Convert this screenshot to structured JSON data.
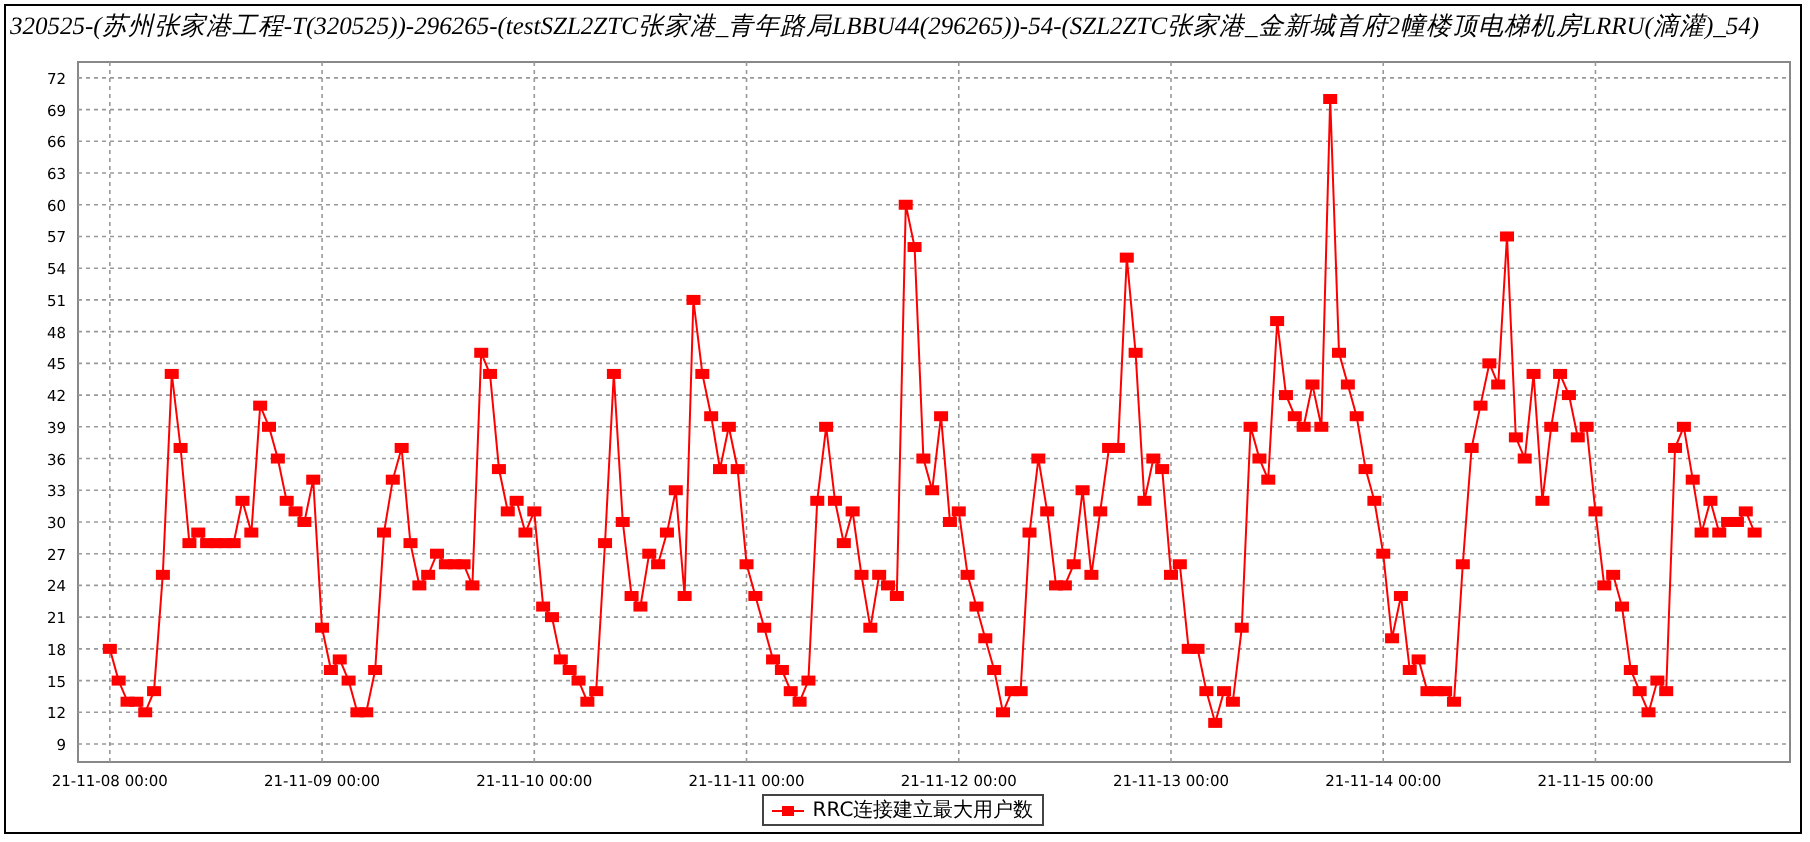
{
  "title": "320525-(苏州张家港工程-T(320525))-296265-(testSZL2ZTC张家港_青年路局LBBU44(296265))-54-(SZL2ZTC张家港_金新城首府2幢楼顶电梯机房LRRU(滴灌)_54)",
  "chart": {
    "chart_data": {
      "type": "line",
      "grid": true,
      "ylim": [
        7.3,
        73.5
      ],
      "yticks": [
        9,
        12,
        15,
        18,
        21,
        24,
        27,
        30,
        33,
        36,
        39,
        42,
        45,
        48,
        51,
        54,
        57,
        60,
        63,
        66,
        69,
        72
      ],
      "categories": [
        "21-11-08 00:00",
        null,
        null,
        null,
        null,
        null,
        null,
        null,
        null,
        null,
        null,
        null,
        null,
        null,
        null,
        null,
        null,
        null,
        null,
        null,
        null,
        null,
        null,
        null,
        "21-11-09 00:00",
        null,
        null,
        null,
        null,
        null,
        null,
        null,
        null,
        null,
        null,
        null,
        null,
        null,
        null,
        null,
        null,
        null,
        null,
        null,
        null,
        null,
        null,
        null,
        "21-11-10 00:00",
        null,
        null,
        null,
        null,
        null,
        null,
        null,
        null,
        null,
        null,
        null,
        null,
        null,
        null,
        null,
        null,
        null,
        null,
        null,
        null,
        null,
        null,
        null,
        "21-11-11 00:00",
        null,
        null,
        null,
        null,
        null,
        null,
        null,
        null,
        null,
        null,
        null,
        null,
        null,
        null,
        null,
        null,
        null,
        null,
        null,
        null,
        null,
        null,
        null,
        "21-11-12 00:00",
        null,
        null,
        null,
        null,
        null,
        null,
        null,
        null,
        null,
        null,
        null,
        null,
        null,
        null,
        null,
        null,
        null,
        null,
        null,
        null,
        null,
        null,
        null,
        "21-11-13 00:00",
        null,
        null,
        null,
        null,
        null,
        null,
        null,
        null,
        null,
        null,
        null,
        null,
        null,
        null,
        null,
        null,
        null,
        null,
        null,
        null,
        null,
        null,
        null,
        "21-11-14 00:00",
        null,
        null,
        null,
        null,
        null,
        null,
        null,
        null,
        null,
        null,
        null,
        null,
        null,
        null,
        null,
        null,
        null,
        null,
        null,
        null,
        null,
        null,
        null,
        "21-11-15 00:00",
        null,
        null,
        null,
        null,
        null,
        null,
        null,
        null,
        null,
        null,
        null,
        null,
        null,
        null,
        null,
        null,
        null,
        null
      ],
      "series": [
        {
          "name": "RRC连接建立最大用户数",
          "color": "#ff0000",
          "marker": "square",
          "values": [
            18,
            15,
            13,
            13,
            12,
            14,
            25,
            44,
            37,
            28,
            29,
            28,
            28,
            28,
            28,
            32,
            29,
            41,
            39,
            36,
            32,
            31,
            30,
            34,
            20,
            16,
            17,
            15,
            12,
            12,
            16,
            29,
            34,
            37,
            28,
            24,
            25,
            27,
            26,
            26,
            26,
            24,
            46,
            44,
            35,
            31,
            32,
            29,
            31,
            22,
            21,
            17,
            16,
            15,
            13,
            14,
            28,
            44,
            30,
            23,
            22,
            27,
            26,
            29,
            33,
            23,
            51,
            44,
            40,
            35,
            39,
            35,
            26,
            23,
            20,
            17,
            16,
            14,
            13,
            15,
            32,
            39,
            32,
            28,
            31,
            25,
            20,
            25,
            24,
            23,
            60,
            56,
            36,
            33,
            40,
            30,
            31,
            25,
            22,
            19,
            16,
            12,
            14,
            14,
            29,
            36,
            31,
            24,
            24,
            26,
            33,
            25,
            31,
            37,
            37,
            55,
            46,
            32,
            36,
            35,
            25,
            26,
            18,
            18,
            14,
            11,
            14,
            13,
            20,
            39,
            36,
            34,
            49,
            42,
            40,
            39,
            43,
            39,
            70,
            46,
            43,
            40,
            35,
            32,
            27,
            19,
            23,
            16,
            17,
            14,
            14,
            14,
            13,
            26,
            37,
            41,
            45,
            43,
            57,
            38,
            36,
            44,
            32,
            39,
            44,
            42,
            38,
            39,
            31,
            24,
            25,
            22,
            16,
            14,
            12,
            15,
            14,
            37,
            39,
            34,
            29,
            32,
            29,
            30,
            30,
            31,
            29
          ]
        }
      ]
    }
  }
}
